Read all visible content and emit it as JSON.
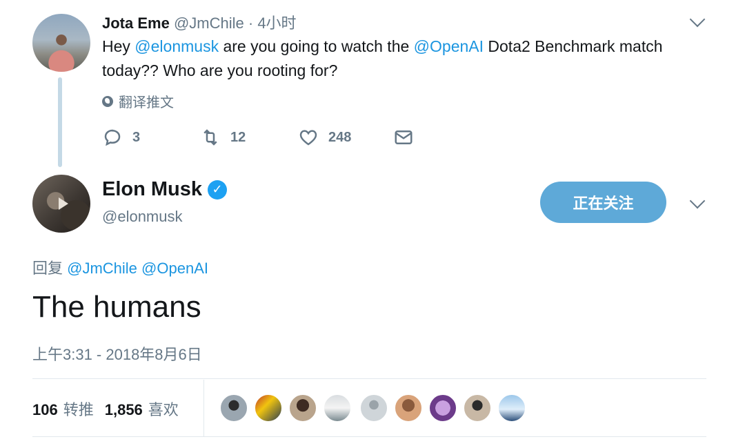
{
  "parent_tweet": {
    "name": "Jota Eme",
    "handle": "@JmChile",
    "time": "· 4小时",
    "text_before": "Hey ",
    "mention_1": "@elonmusk",
    "text_middle": " are you going to watch the ",
    "mention_2": "@OpenAI",
    "text_after": " Dota2 Benchmark match today?? Who are you rooting for?",
    "translate_label": "翻译推文",
    "actions": {
      "reply_count": "3",
      "retweet_count": "12",
      "like_count": "248"
    }
  },
  "main_tweet": {
    "name": "Elon Musk",
    "handle": "@elonmusk",
    "follow_label": "正在关注",
    "reply_prefix": "回复 ",
    "reply_mention_1": "@JmChile",
    "reply_mention_2": "@OpenAI",
    "text": "The humans",
    "timestamp": "上午3:31 - 2018年8月6日",
    "retweets_count": "106",
    "retweets_label": "转推",
    "likes_count": "1,856",
    "likes_label": "喜欢"
  },
  "colors": {
    "link": "#1b95e0",
    "secondary_text": "#657786",
    "follow_button": "#5ea9d8",
    "verified": "#1da1f2"
  },
  "icons": [
    "globe-icon",
    "reply-icon",
    "retweet-icon",
    "like-icon",
    "dm-icon",
    "verified-icon",
    "chevron-down-icon",
    "play-icon"
  ]
}
